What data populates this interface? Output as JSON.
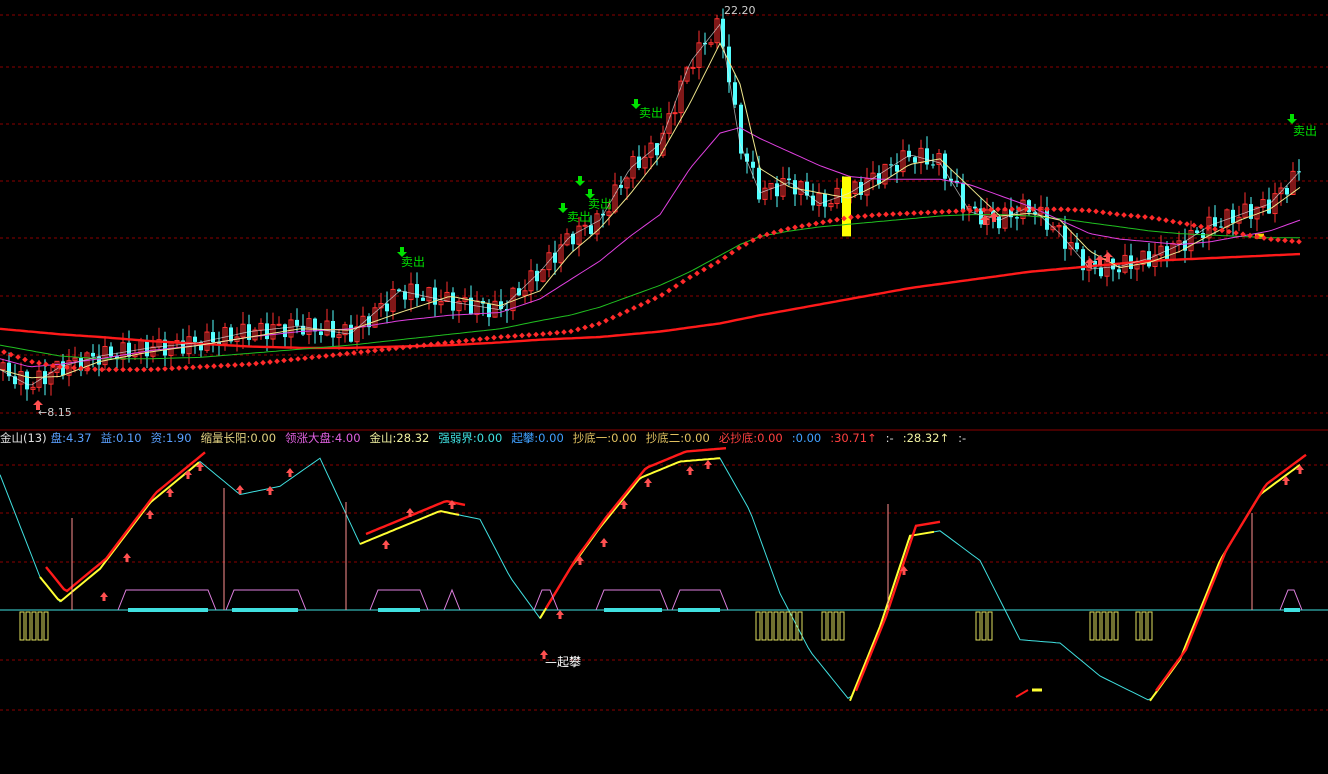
{
  "colors": {
    "background": "#000000",
    "grid": "#8b0000",
    "up_candle": "#ff3030",
    "down_candle": "#54ffff",
    "ma_long": "#ff1a1a",
    "dots": "#ff2a2a",
    "ma_green": "#20c020",
    "ma_magenta": "#e040e0",
    "ma_yellow": "#f0e68c",
    "ma_white": "#e8e8e8",
    "osc_cyan": "#40e0e0",
    "osc_yellow": "#ffff33",
    "osc_red": "#ff1a1a",
    "baseline": "#40e0e0",
    "pink_line": "#ff9090",
    "buy_arrow": "#ff5050",
    "sell_arrow": "#00e000"
  },
  "price_panel": {
    "high_label": "22.20",
    "low_label": "8.15",
    "sell_label": "卖出",
    "buy_icon": "up-arrow-icon",
    "sell_icon": "down-arrow-icon"
  },
  "indicator_bar": [
    {
      "key": "title",
      "text": "金山(13)",
      "color": "#e0e0e0"
    },
    {
      "key": "pan",
      "text": "盘:4.37",
      "color": "#5aa0ff"
    },
    {
      "key": "yi",
      "text": "益:0.10",
      "color": "#5aa0ff"
    },
    {
      "key": "zi",
      "text": "资:1.90",
      "color": "#5aa0ff"
    },
    {
      "key": "suoliang",
      "text": "缩量长阳:0.00",
      "color": "#e0d080"
    },
    {
      "key": "lingzhang",
      "text": "领涨大盘:4.00",
      "color": "#e060e0"
    },
    {
      "key": "jinshan",
      "text": "金山:28.32",
      "color": "#f0f0a0"
    },
    {
      "key": "qiangruo",
      "text": "强弱界:0.00",
      "color": "#40e0e0"
    },
    {
      "key": "qipan",
      "text": "起攀:0.00",
      "color": "#40a0ff"
    },
    {
      "key": "chaodi1",
      "text": "抄底一:0.00",
      "color": "#e0c060"
    },
    {
      "key": "chaodi2",
      "text": "抄底二:0.00",
      "color": "#e0c060"
    },
    {
      "key": "bichaodi",
      "text": "必抄底:0.00",
      "color": "#ff4040"
    },
    {
      "key": "blank1",
      "text": ":0.00",
      "color": "#40a0ff"
    },
    {
      "key": "val30",
      "text": ":30.71↑",
      "color": "#ff4040"
    },
    {
      "key": "dash",
      "text": ":-",
      "color": "#e0e0e0"
    },
    {
      "key": "val28",
      "text": ":28.32↑",
      "color": "#f0f0a0"
    },
    {
      "key": "tail",
      "text": ":-",
      "color": "#e0e0e0"
    }
  ],
  "oscillator_panel": {
    "qipan_label": "起攀"
  },
  "chart_data": {
    "type": "line",
    "price": {
      "x": [
        0,
        30,
        60,
        100,
        150,
        200,
        250,
        300,
        350,
        400,
        450,
        500,
        540,
        570,
        600,
        630,
        660,
        690,
        720,
        740,
        760,
        790,
        820,
        850,
        880,
        910,
        940,
        970,
        1000,
        1030,
        1060,
        1090,
        1120,
        1150,
        1180,
        1210,
        1240,
        1270,
        1300
      ],
      "close": [
        8.9,
        8.3,
        9.0,
        9.4,
        9.7,
        9.9,
        10.3,
        10.5,
        10.2,
        11.8,
        11.4,
        11.1,
        12.5,
        13.8,
        14.4,
        16.3,
        17.2,
        20.2,
        21.6,
        17.2,
        15.4,
        15.8,
        15.0,
        15.4,
        16.1,
        16.8,
        16.5,
        14.7,
        14.4,
        14.9,
        13.9,
        12.6,
        12.7,
        13.0,
        13.5,
        14.2,
        14.6,
        15.0,
        16.2
      ],
      "high_mark": 22.2,
      "low_mark": 8.15,
      "ma_long": [
        10.4,
        10.3,
        10.2,
        10.1,
        9.95,
        9.85,
        9.75,
        9.7,
        9.7,
        9.75,
        9.8,
        9.9,
        10.0,
        10.05,
        10.1,
        10.2,
        10.3,
        10.45,
        10.6,
        10.75,
        10.9,
        11.1,
        11.3,
        11.5,
        11.7,
        11.9,
        12.05,
        12.2,
        12.35,
        12.5,
        12.6,
        12.7,
        12.8,
        12.9,
        12.95,
        13.0,
        13.05,
        13.1,
        13.15
      ],
      "dots": [
        9.6,
        9.2,
        9.0,
        8.9,
        8.9,
        9.0,
        9.1,
        9.3,
        9.5,
        9.7,
        9.9,
        10.1,
        10.2,
        10.3,
        10.6,
        11.1,
        11.6,
        12.3,
        12.9,
        13.4,
        13.8,
        14.1,
        14.3,
        14.5,
        14.6,
        14.65,
        14.7,
        14.75,
        14.8,
        14.8,
        14.8,
        14.75,
        14.6,
        14.5,
        14.3,
        14.1,
        13.9,
        13.7,
        13.6
      ],
      "ma_green": [
        9.8,
        9.6,
        9.4,
        9.3,
        9.3,
        9.35,
        9.5,
        9.65,
        9.8,
        10.0,
        10.2,
        10.4,
        10.7,
        10.9,
        11.2,
        11.6,
        12.0,
        12.5,
        13.1,
        13.5,
        13.8,
        14.0,
        14.15,
        14.25,
        14.35,
        14.45,
        14.55,
        14.6,
        14.6,
        14.55,
        14.45,
        14.3,
        14.15,
        14.0,
        13.9,
        13.85,
        13.8,
        13.75,
        13.75
      ],
      "ma_magenta": [
        9.3,
        9.0,
        9.1,
        9.3,
        9.6,
        9.8,
        10.1,
        10.3,
        10.4,
        10.7,
        10.9,
        11.0,
        11.5,
        12.2,
        12.9,
        13.8,
        14.6,
        16.3,
        17.6,
        17.8,
        17.4,
        16.9,
        16.4,
        16.0,
        15.9,
        15.9,
        15.9,
        15.7,
        15.3,
        14.9,
        14.4,
        13.9,
        13.7,
        13.6,
        13.5,
        13.6,
        13.8,
        14.0,
        14.4
      ]
    },
    "oscillator": {
      "x": [
        0,
        40,
        60,
        100,
        150,
        200,
        240,
        280,
        320,
        360,
        400,
        440,
        480,
        510,
        540,
        570,
        600,
        640,
        680,
        720,
        750,
        780,
        810,
        850,
        880,
        910,
        940,
        980,
        1020,
        1060,
        1100,
        1150,
        1180,
        1220,
        1260,
        1300
      ],
      "y": [
        82,
        20,
        5,
        25,
        65,
        90,
        70,
        75,
        92,
        40,
        50,
        60,
        55,
        20,
        -5,
        25,
        50,
        80,
        90,
        92,
        60,
        10,
        -25,
        -55,
        -10,
        45,
        48,
        30,
        -18,
        -20,
        -40,
        -55,
        -30,
        30,
        70,
        88
      ]
    }
  }
}
